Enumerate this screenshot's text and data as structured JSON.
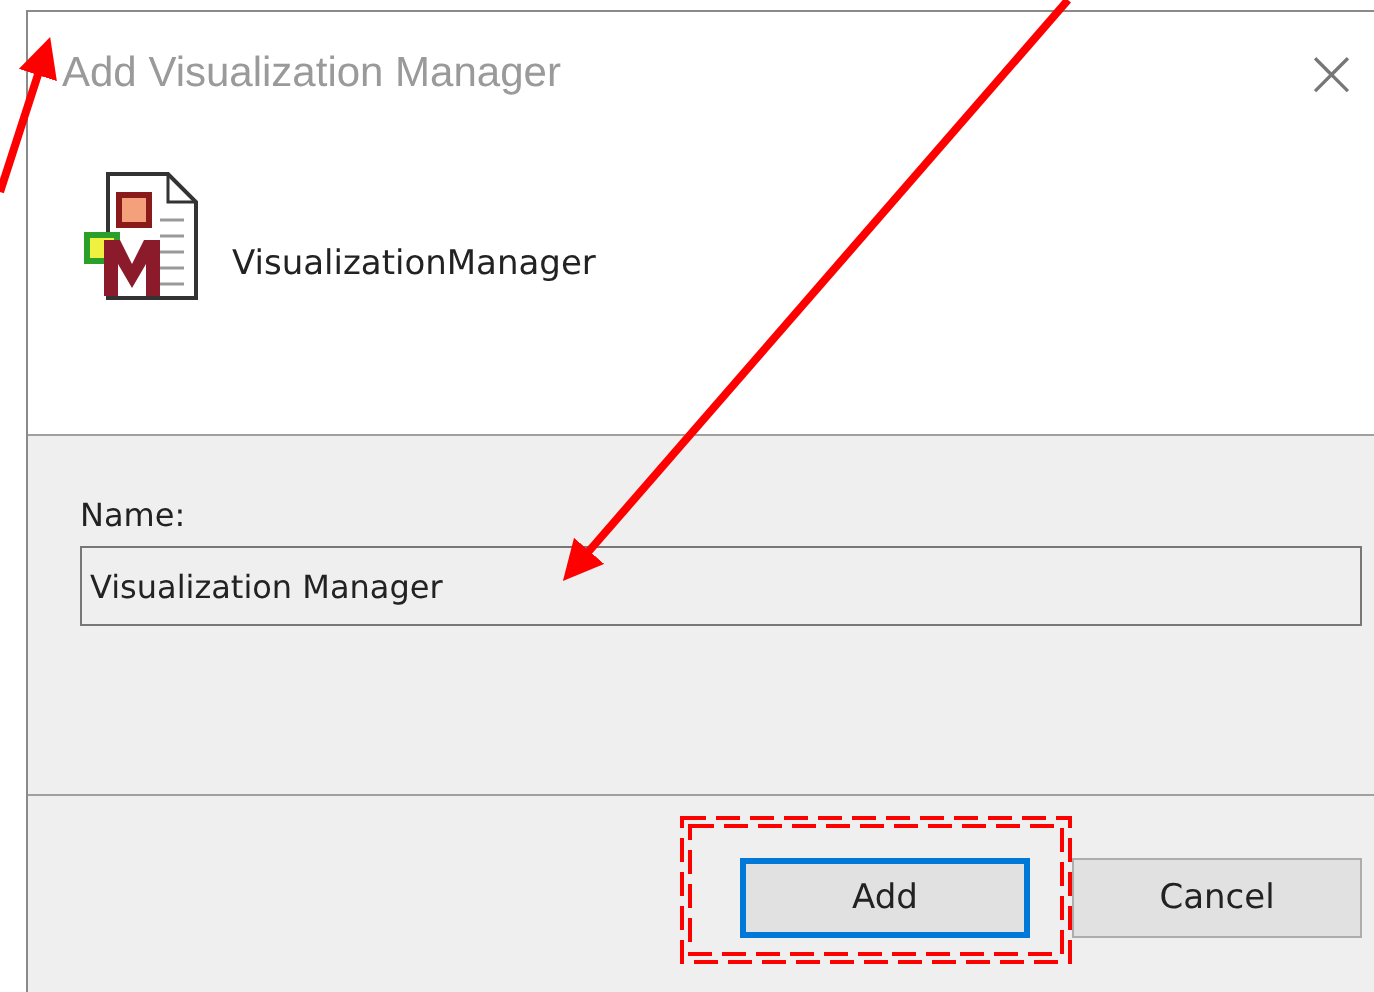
{
  "window": {
    "title": "Add Visualization Manager",
    "close_glyph": "×"
  },
  "item": {
    "name": "VisualizationManager"
  },
  "name_field": {
    "label": "Name:",
    "value": "Visualization Manager"
  },
  "buttons": [
    {
      "label": "Add",
      "default": true
    },
    {
      "label": "Cancel",
      "default": false
    }
  ],
  "annotations": [
    {
      "kind": "arrow"
    },
    {
      "kind": "arrow"
    },
    {
      "kind": "highlight"
    }
  ]
}
